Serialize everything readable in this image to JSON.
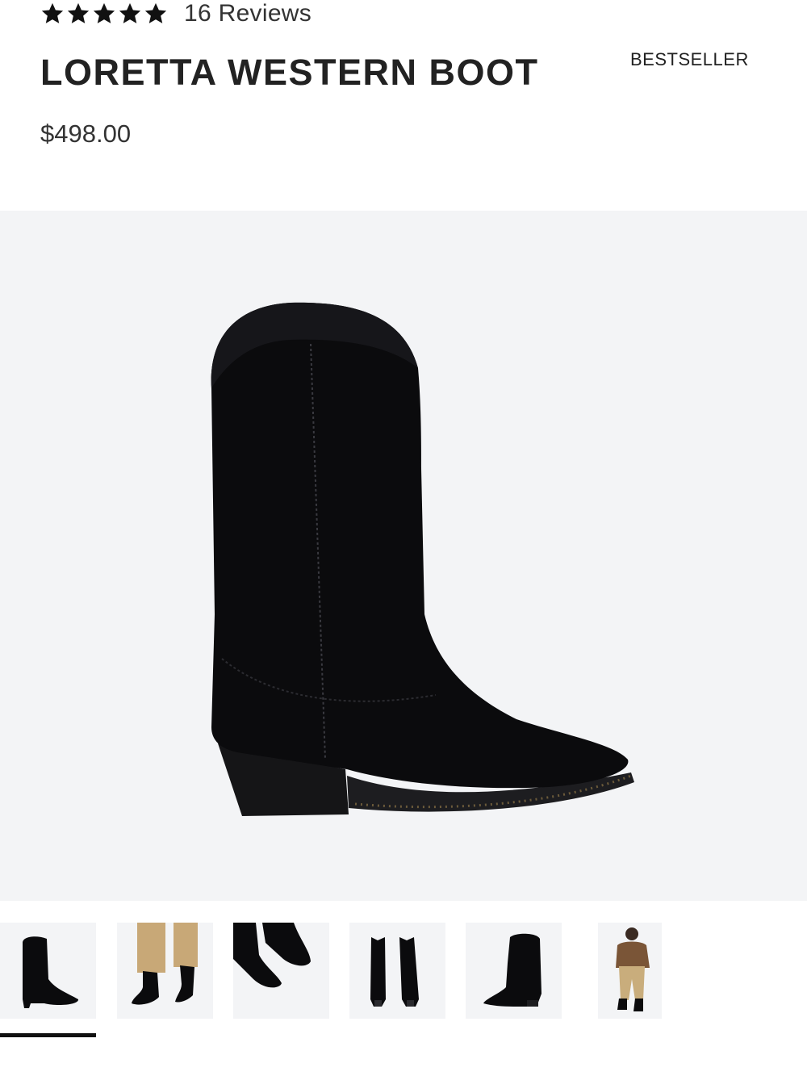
{
  "product": {
    "rating": 5,
    "reviews_label": "16 Reviews",
    "title": "LORETTA WESTERN BOOT",
    "badge": "BESTSELLER",
    "price": "$498.00"
  },
  "gallery": {
    "main_image_icon": "black-suede-western-boot-image",
    "thumbnails": [
      {
        "icon": "boot-side-view-thumbnail",
        "active": true
      },
      {
        "icon": "boots-worn-with-khaki-pants-thumbnail",
        "active": false
      },
      {
        "icon": "boot-toe-closeup-thumbnail",
        "active": false
      },
      {
        "icon": "boot-pair-back-view-thumbnail",
        "active": false
      },
      {
        "icon": "boot-front-angle-thumbnail",
        "active": false
      },
      {
        "icon": "model-full-outfit-thumbnail",
        "active": false
      }
    ]
  },
  "colors": {
    "text": "#222222",
    "image_background": "#f3f4f6",
    "boot": "#0b0b0d",
    "active_indicator": "#111111"
  }
}
